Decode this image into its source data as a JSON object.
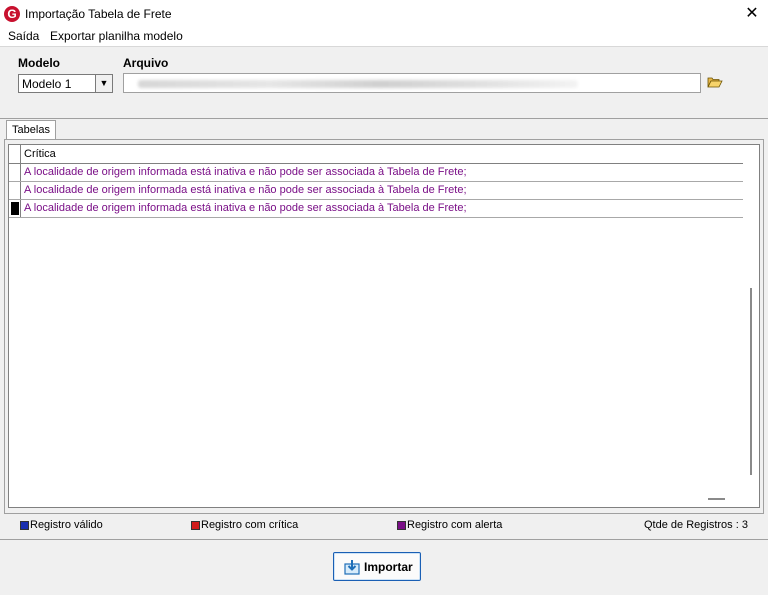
{
  "window": {
    "title": "Importação Tabela de Frete",
    "app_icon_letter": "G",
    "close_glyph": "✕"
  },
  "menu": {
    "items": [
      {
        "label": "Saída"
      },
      {
        "label": "Exportar planilha modelo"
      }
    ]
  },
  "form": {
    "modelo_label": "Modelo",
    "modelo_value": "Modelo 1",
    "arquivo_label": "Arquivo",
    "arquivo_value": ""
  },
  "tabs": [
    {
      "label": "Tabelas"
    }
  ],
  "grid": {
    "column_header": "Crítica",
    "rows": [
      {
        "text": "A localidade de origem informada está inativa e não pode ser associada à Tabela de Frete;"
      },
      {
        "text": "A localidade de origem informada está inativa e não pode ser associada à Tabela de Frete;"
      },
      {
        "text": "A localidade de origem informada está inativa e não pode ser associada à Tabela de Frete;"
      }
    ],
    "row_text_color": "#7a0f87"
  },
  "legend": {
    "valid_label": "Registro válido",
    "valid_color": "#1a2fb0",
    "critical_label": "Registro com crítica",
    "critical_color": "#d01c1c",
    "alert_label": "Registro com alerta",
    "alert_color": "#7a0f87",
    "count_text": "Qtde de Registros : 3"
  },
  "actions": {
    "import_label": "Importar"
  },
  "icons": {
    "app": "app-logo-icon",
    "close": "close-icon",
    "dropdown": "chevron-down-icon",
    "folder": "folder-open-icon",
    "import": "import-download-icon"
  }
}
